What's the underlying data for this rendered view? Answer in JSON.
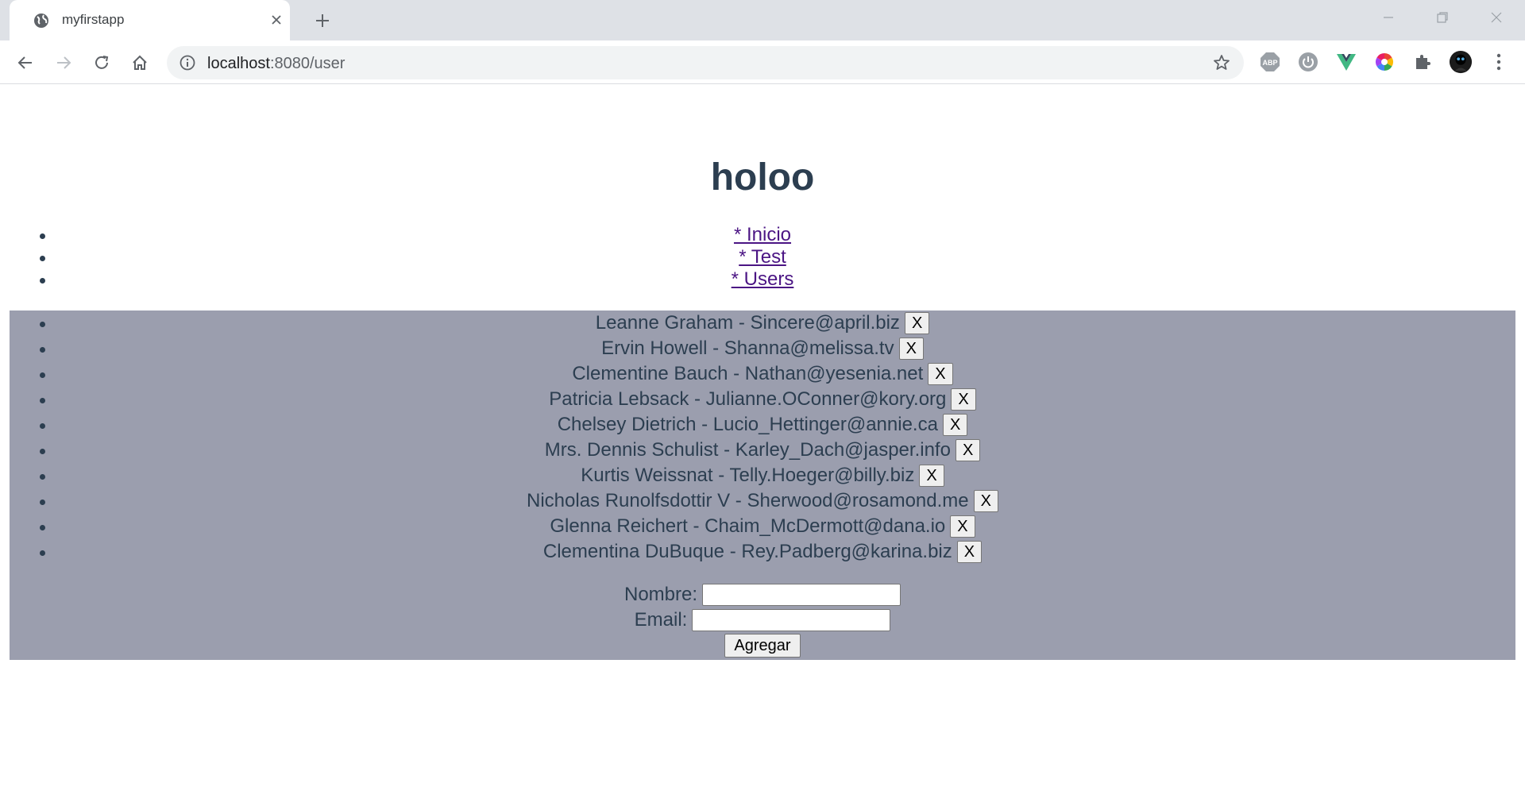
{
  "browser": {
    "tab_title": "myfirstapp",
    "url_host": "localhost",
    "url_path": ":8080/user"
  },
  "page": {
    "title": "holoo",
    "nav": [
      {
        "label": "* Inicio"
      },
      {
        "label": "* Test"
      },
      {
        "label": "* Users"
      }
    ],
    "users": [
      {
        "text": "Leanne Graham - Sincere@april.biz",
        "delete_label": "X"
      },
      {
        "text": "Ervin Howell - Shanna@melissa.tv",
        "delete_label": "X"
      },
      {
        "text": "Clementine Bauch - Nathan@yesenia.net",
        "delete_label": "X"
      },
      {
        "text": "Patricia Lebsack - Julianne.OConner@kory.org",
        "delete_label": "X"
      },
      {
        "text": "Chelsey Dietrich - Lucio_Hettinger@annie.ca",
        "delete_label": "X"
      },
      {
        "text": "Mrs. Dennis Schulist - Karley_Dach@jasper.info",
        "delete_label": "X"
      },
      {
        "text": "Kurtis Weissnat - Telly.Hoeger@billy.biz",
        "delete_label": "X"
      },
      {
        "text": "Nicholas Runolfsdottir V - Sherwood@rosamond.me",
        "delete_label": "X"
      },
      {
        "text": "Glenna Reichert - Chaim_McDermott@dana.io",
        "delete_label": "X"
      },
      {
        "text": "Clementina DuBuque - Rey.Padberg@karina.biz",
        "delete_label": "X"
      }
    ],
    "form": {
      "name_label": "Nombre:",
      "name_value": "",
      "email_label": "Email:",
      "email_value": "",
      "submit_label": "Agregar"
    }
  },
  "colors": {
    "heading": "#2c3e50",
    "link_visited": "#4b1584",
    "panel_bg": "#9b9eae"
  }
}
